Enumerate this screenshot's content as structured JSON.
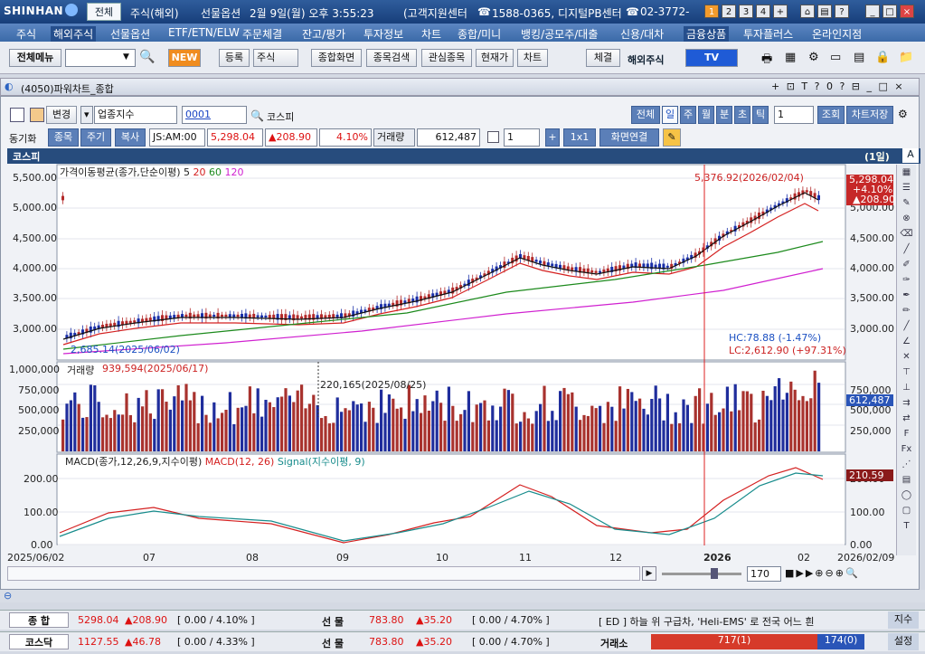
{
  "title": {
    "logo": "SHINHAN",
    "tab_all": "전체",
    "t1": "주식(해외)",
    "t2": "선물옵션",
    "t3": "2월 9일(월) 오후 3:55:23",
    "t4": "(고객지원센터",
    "t5": "1588-0365, 디지털PB센터",
    "t6": "02-3772-",
    "n1": "1",
    "n2": "2",
    "n3": "3",
    "n4": "4"
  },
  "menu": [
    "주식",
    "해외주식",
    "선물옵션",
    "ETF/ETN/ELW",
    "주문체결",
    "잔고/평가",
    "투자정보",
    "차트",
    "종합/미니",
    "뱅킹/공모주/대출",
    "신용/대차",
    "금융상품",
    "투자플러스",
    "온라인지점"
  ],
  "tool": {
    "allmenu": "전체메뉴",
    "new": "NEW",
    "reg": "등록",
    "stock": "주식",
    "b1": "종합화면",
    "b2": "종목검색",
    "b3": "관심종목",
    "b4": "현재가",
    "b5": "차트",
    "exec": "체결",
    "foreign": "해외주식",
    "tv": "TV"
  },
  "win": {
    "title": "(4050)파워차트_종합",
    "change": "변경",
    "index": "업종지수",
    "code": "0001",
    "name": "코스피",
    "periods": [
      "전체",
      "일",
      "주",
      "월",
      "분",
      "초",
      "틱"
    ],
    "count": "1",
    "query": "조회",
    "save": "차트저장",
    "sync": "동기화",
    "b_item": "종목",
    "b_period": "주기",
    "b_copy": "복사",
    "time": "JS:AM:00",
    "price": "5,298.04",
    "chg": "▲208.90",
    "pct": "4.10%",
    "vol_lbl": "거래량",
    "vol": "612,487",
    "n": "1",
    "ratio": "1x1",
    "link": "화면연결"
  },
  "chart": {
    "name": "코스피",
    "period": "(1일)",
    "btnA": "A",
    "ma_lbl": "가격이동평균(종가,단순이평)",
    "ma5": "5",
    "ma20": "20",
    "ma60": "60",
    "ma120": "120",
    "price_ticks": [
      "5,500.00",
      "5,000.00",
      "4,500.00",
      "4,000.00",
      "3,500.00",
      "3,000.00"
    ],
    "r_price_ticks": [
      "5,000.00",
      "4,500.00",
      "4,000.00",
      "3,500.00",
      "3,000.00"
    ],
    "hi": "5,376.92(2026/02/04)",
    "lo": "2,685.14(2025/06/02)",
    "hc": "HC:78.88 (-1.47%)",
    "lc": "LC:2,612.90 (+97.31%)",
    "last": "5,298.04",
    "last_pct": "+4.10%",
    "last_chg": "▲208.90",
    "vol_title": "거래량",
    "vol_ticks": [
      "1,000,000",
      "750,000",
      "500,000",
      "250,000"
    ],
    "r_vol_ticks": [
      "750,000",
      "500,000",
      "250,000"
    ],
    "vol_hi": "939,594(2025/06/17)",
    "vol_mark": "220,165(2025/08/25)",
    "vol_last": "612,487",
    "macd_title": "MACD(종가,12,26,9,지수이평)",
    "macd_lbl": "MACD(12, 26)",
    "sig_lbl": "Signal(지수이평, 9)",
    "macd_ticks": [
      "200.00",
      "100.00",
      "0.00"
    ],
    "r_macd_ticks": [
      "200.00",
      "100.00",
      "0.00"
    ],
    "macd_last": "210.59",
    "dates": [
      "2025/06/02",
      "07",
      "08",
      "09",
      "10",
      "11",
      "12",
      "2026",
      "02",
      "2026/02/09"
    ],
    "zoom": "170"
  },
  "bottom": {
    "r1": {
      "name": "종 합",
      "val": "5298.04",
      "chg": "▲208.90",
      "pct": "[ 0.00  / 4.10% ]",
      "fut": "선  물",
      "fval": "783.80",
      "fchg": "▲35.20",
      "fpct": "[ 0.00  / 4.70% ]",
      "news": "[ ED ] 하늘 위 구급차, 'Heli-EMS' 로 전국 어느 흰",
      "idx": "지수"
    },
    "r2": {
      "name": "코스닥",
      "val": "1127.55",
      "chg": "▲46.78",
      "pct": "[ 0.00  / 4.33% ]",
      "fut": "선  물",
      "fval": "783.80",
      "fchg": "▲35.20",
      "fpct": "[ 0.00  / 4.70% ]",
      "exch": "거래소",
      "up": "717(1)",
      "down": "174(0)",
      "setting": "설정"
    }
  },
  "colors": {
    "up": "#b32a2a",
    "down": "#1a2fa8",
    "ma5": "#111111",
    "ma20": "#d42020",
    "ma60": "#1c8a1c",
    "ma120": "#d020d0"
  }
}
